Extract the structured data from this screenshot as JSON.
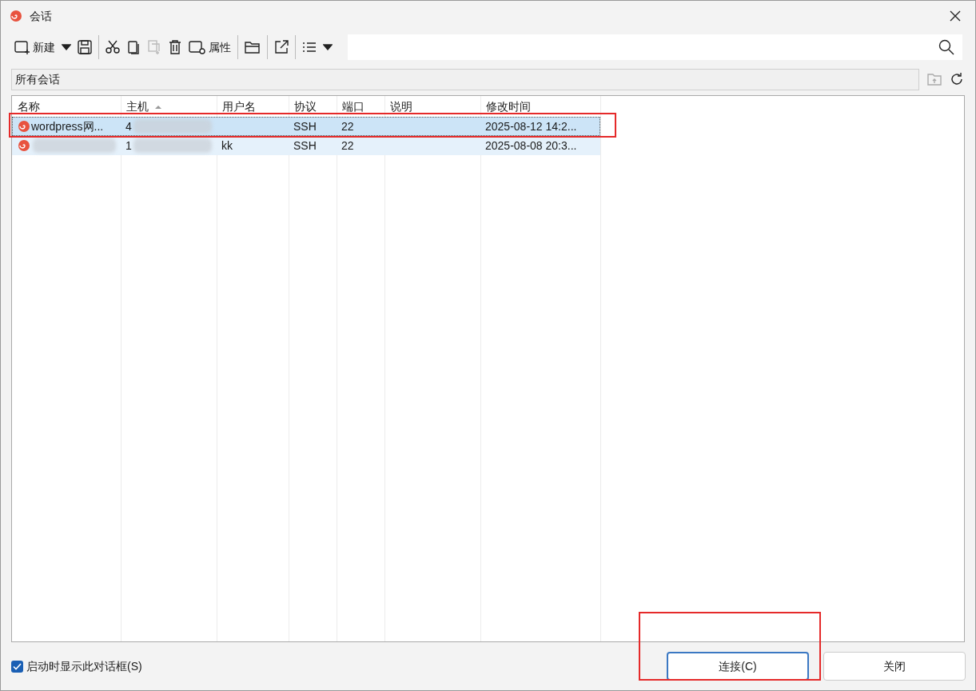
{
  "window": {
    "title": "会话"
  },
  "toolbar": {
    "new_label": "新建",
    "properties_label": "属性"
  },
  "path_bar": {
    "value": "所有会话"
  },
  "table": {
    "columns": [
      {
        "label": "名称",
        "sorted": false
      },
      {
        "label": "主机",
        "sorted": true
      },
      {
        "label": "用户名",
        "sorted": false
      },
      {
        "label": "协议",
        "sorted": false
      },
      {
        "label": "端口",
        "sorted": false
      },
      {
        "label": "说明",
        "sorted": false
      },
      {
        "label": "修改时间",
        "sorted": false
      }
    ],
    "rows": [
      {
        "selected": true,
        "highlighted": true,
        "cells": [
          "wordpress网...",
          "4",
          null,
          "SSH",
          "22",
          null,
          "2025-08-12 14:2..."
        ],
        "blurred": [
          false,
          true
        ]
      },
      {
        "selected": false,
        "highlighted": false,
        "cells": [
          null,
          "1",
          "kk",
          "SSH",
          "22",
          null,
          "2025-08-08 20:3..."
        ],
        "blurred": [
          true,
          true
        ]
      }
    ]
  },
  "footer": {
    "show_on_startup": {
      "label": "启动时显示此对话框(S)",
      "checked": true
    },
    "buttons": [
      {
        "label": "连接(C)",
        "highlighted": true
      },
      {
        "label": "关闭",
        "highlighted": false
      }
    ]
  }
}
